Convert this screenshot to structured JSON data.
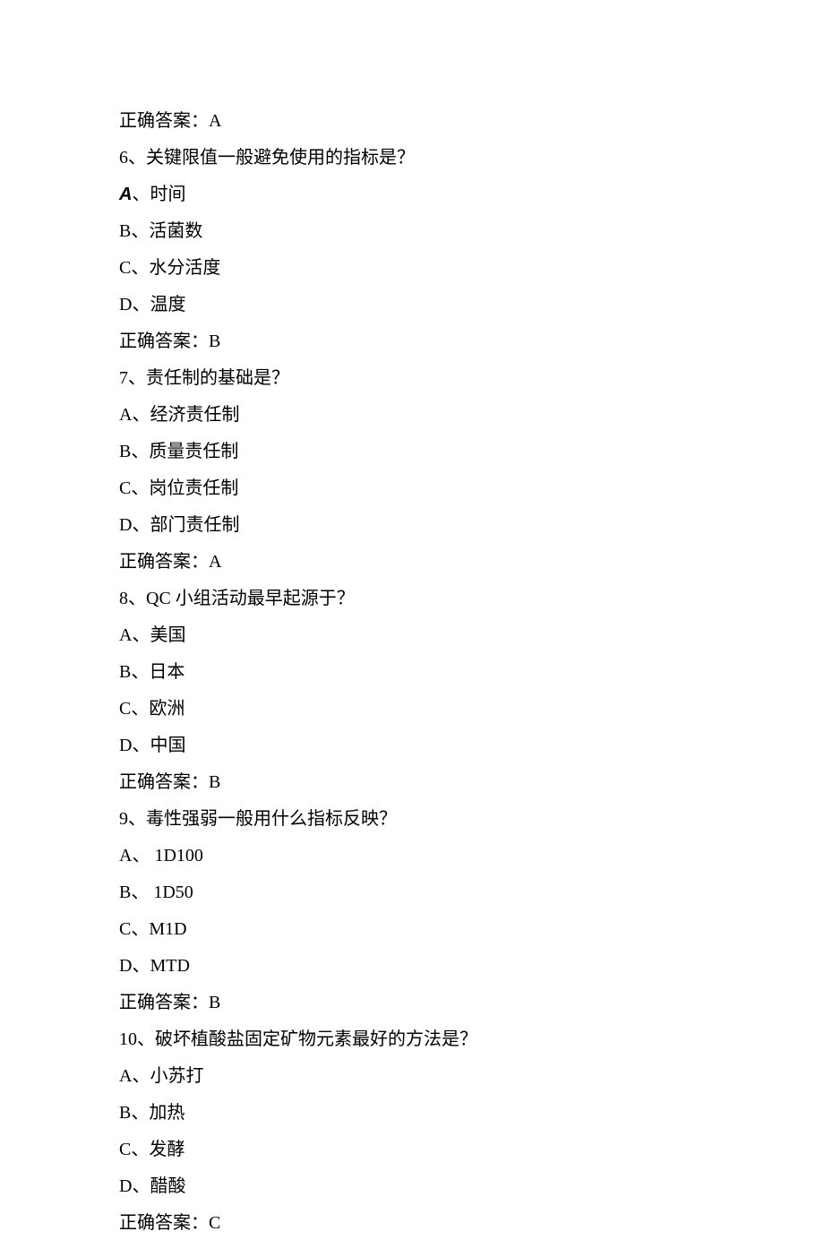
{
  "lines": {
    "q5_answer": "正确答案：A",
    "q6": "6、关键限值一般避免使用的指标是？",
    "q6_a_prefix": "A",
    "q6_a_text": "、时间",
    "q6_b": "B、活菌数",
    "q6_c": "C、水分活度",
    "q6_d": "D、温度",
    "q6_answer": "正确答案：B",
    "q7": "7、责任制的基础是？",
    "q7_a": "A、经济责任制",
    "q7_b": "B、质量责任制",
    "q7_c": "C、岗位责任制",
    "q7_d": "D、部门责任制",
    "q7_answer": "正确答案：A",
    "q8": "8、QC 小组活动最早起源于？",
    "q8_a": "A、美国",
    "q8_b": "B、日本",
    "q8_c": "C、欧洲",
    "q8_d": "D、中国",
    "q8_answer": "正确答案：B",
    "q9": "9、毒性强弱一般用什么指标反映？",
    "q9_a": "A、 1D100",
    "q9_b": "B、 1D50",
    "q9_c": "C、M1D",
    "q9_d": "D、MTD",
    "q9_answer": "正确答案：B",
    "q10": "10、破坏植酸盐固定矿物元素最好的方法是？",
    "q10_a": "A、小苏打",
    "q10_b": "B、加热",
    "q10_c": "C、发酵",
    "q10_d": "D、醋酸",
    "q10_answer": "正确答案：C"
  }
}
